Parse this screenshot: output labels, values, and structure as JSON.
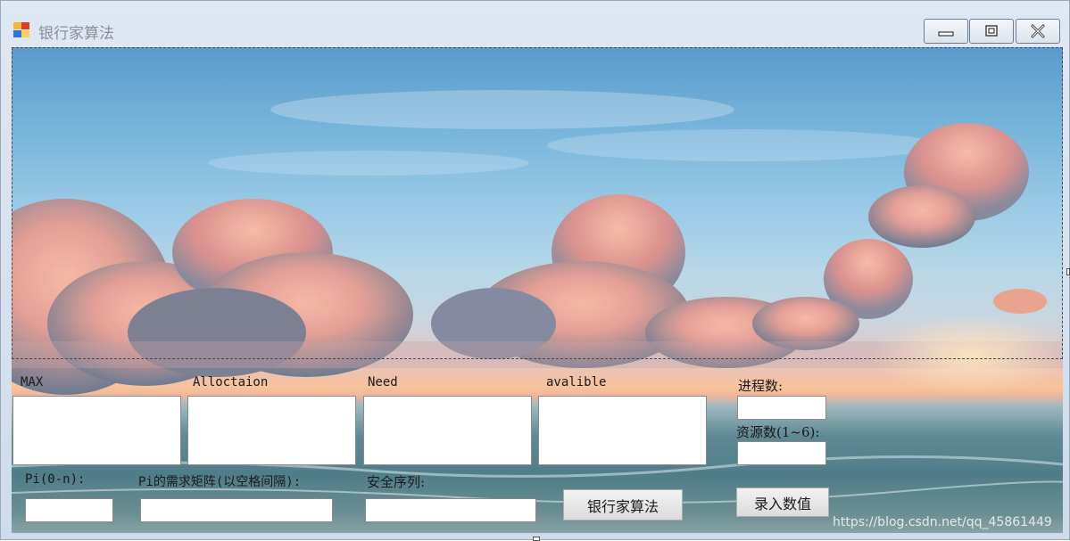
{
  "window": {
    "title": "银行家算法",
    "icon": "app-icon",
    "controls": [
      "minimize-icon",
      "maximize-icon",
      "close-icon"
    ]
  },
  "matrices": {
    "max_label": "MAX",
    "allocation_label": "Alloctaion",
    "need_label": "Need",
    "available_label": "avalible",
    "max_value": "",
    "allocation_value": "",
    "need_value": "",
    "available_value": ""
  },
  "settings": {
    "process_count_label": "进程数:",
    "resource_count_label": "资源数(1~6):",
    "process_count_value": "",
    "resource_count_value": ""
  },
  "request": {
    "pi_label": "Pi(0-n):",
    "pi_value": "",
    "request_label": "Pi的需求矩阵(以空格间隔):",
    "request_value": "",
    "safe_seq_label": "安全序列:",
    "safe_seq_value": ""
  },
  "buttons": {
    "banker_label": "银行家算法",
    "enter_label": "录入数值"
  },
  "watermark": "https://blog.csdn.net/qq_45861449"
}
